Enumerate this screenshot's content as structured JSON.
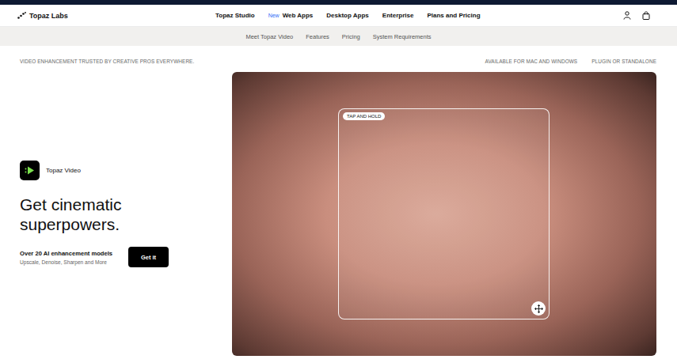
{
  "brand": {
    "name": "Topaz Labs"
  },
  "nav": {
    "items": [
      {
        "label": "Topaz Studio"
      },
      {
        "label": "Web Apps",
        "badge": "New"
      },
      {
        "label": "Desktop Apps"
      },
      {
        "label": "Enterprise"
      },
      {
        "label": "Plans and Pricing"
      }
    ]
  },
  "subnav": {
    "items": [
      "Meet Topaz Video",
      "Features",
      "Pricing",
      "System Requirements"
    ]
  },
  "strip": {
    "tagline": "VIDEO ENHANCEMENT TRUSTED BY CREATIVE PROS EVERYWHERE.",
    "features": [
      "AVAILABLE FOR MAC AND WINDOWS",
      "PLUGIN OR STANDALONE"
    ]
  },
  "product": {
    "name": "Topaz Video",
    "headline": "Get cinematic superpowers.",
    "subhead": "Over 20 AI enhancement models",
    "detail": "Upscale, Denoise, Sharpen and More",
    "cta": "Get it"
  },
  "preview": {
    "badge": "TAP AND HOLD"
  }
}
